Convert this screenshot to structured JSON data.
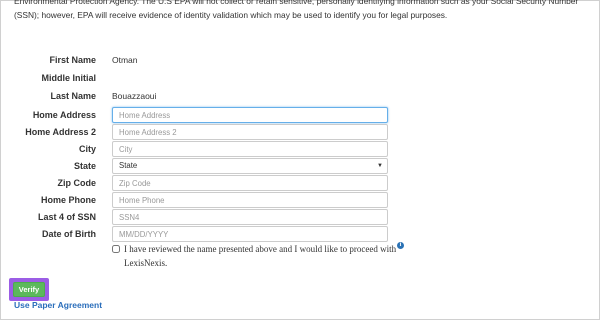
{
  "intro": {
    "line1": "Environmental Protection Agency. The U.S EPA will not collect or retain sensitive, personally identifying information such as your Social Security Number",
    "line2": "(SSN); however, EPA will receive evidence of identity validation which may be used to identify you for legal purposes."
  },
  "form": {
    "first_name_label": "First Name",
    "first_name_value": "Otman",
    "middle_initial_label": "Middle Initial",
    "middle_initial_value": "",
    "last_name_label": "Last Name",
    "last_name_value": "Bouazzaoui",
    "home_address_label": "Home Address",
    "home_address_placeholder": "Home Address",
    "home_address2_label": "Home Address 2",
    "home_address2_placeholder": "Home Address 2",
    "city_label": "City",
    "city_placeholder": "City",
    "state_label": "State",
    "state_selected": "State",
    "zip_label": "Zip Code",
    "zip_placeholder": "Zip Code",
    "home_phone_label": "Home Phone",
    "home_phone_placeholder": "Home Phone",
    "ssn_label": "Last 4 of SSN",
    "ssn_placeholder": "SSN4",
    "dob_label": "Date of Birth",
    "dob_placeholder": "MM/DD/YYYY"
  },
  "consent": {
    "text": "I have reviewed the name presented above and I would like to proceed with LexisNexis.",
    "checked": false
  },
  "icons": {
    "info": "info-icon",
    "dropdown": "chevron-down-icon",
    "info_glyph": "i",
    "caret_glyph": "▼"
  },
  "actions": {
    "verify_label": "Verify",
    "paper_link": "Use Paper Agreement"
  },
  "colors": {
    "verify_button": "#5cb85c",
    "highlight": "#9b5de5",
    "link": "#2a6ebb",
    "info_icon": "#2a72b5",
    "focus_border": "#66afe9"
  }
}
